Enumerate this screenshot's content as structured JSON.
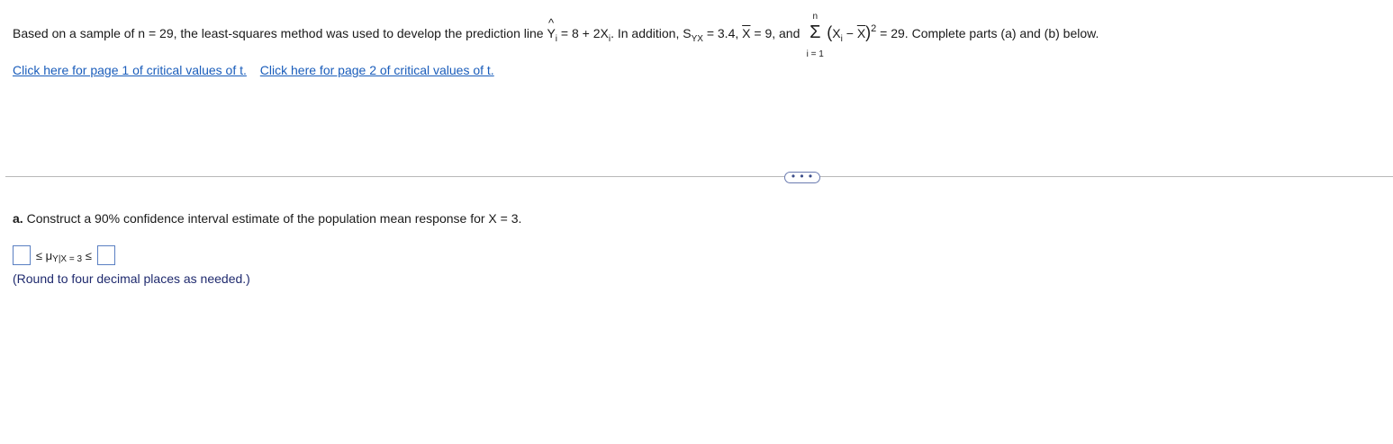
{
  "problem": {
    "part1": "Based on a sample of n = 29, the least-squares method was used to develop the prediction line ",
    "yhat_symbol": "Y",
    "hat_mark": "^",
    "sub_i": "i",
    "eq_rest": " = 8 + 2X",
    "part2": ". In addition, S",
    "sub_yx": "YX",
    "part3": " = 3.4, ",
    "xbar": "X",
    "part4": " = 9, and ",
    "sigma_symbol": "Σ",
    "sigma_top": "n",
    "sigma_bottom": "i = 1",
    "paren_open": "(",
    "x_i": "X",
    "minus": " − ",
    "paren_close": ")",
    "exp_2": "2",
    "part5": " = 29. Complete parts (a) and (b) below."
  },
  "links": {
    "page1": "Click here for page 1 of critical values of t.",
    "page2": "Click here for page 2 of critical values of t."
  },
  "expand_button": "• • •",
  "part_a": {
    "label": "a.",
    "text": " Construct a 90% confidence interval estimate of the population mean response for X = 3."
  },
  "answer": {
    "leq": "≤",
    "mu": "μ",
    "mu_sub": "Y|X = 3"
  },
  "note": "(Round to four decimal places as needed.)"
}
